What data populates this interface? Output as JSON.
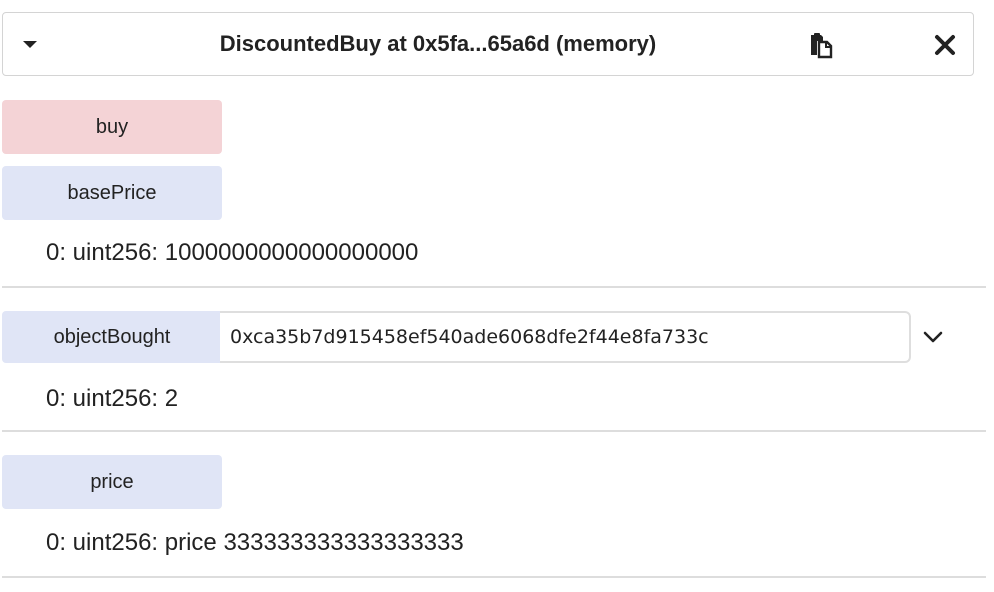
{
  "header": {
    "title": "DiscountedBuy at 0x5fa...65a6d (memory)",
    "collapse_icon": "caret-down-icon",
    "copy_icon": "copy-icon",
    "close_icon": "close-icon"
  },
  "functions": [
    {
      "label": "buy",
      "kind": "transact",
      "color": "#f4d3d6"
    },
    {
      "label": "basePrice",
      "kind": "call",
      "color": "#e0e5f6",
      "output": "0: uint256: 1000000000000000000"
    },
    {
      "label": "objectBought",
      "kind": "call",
      "color": "#e0e5f6",
      "input_value": "0xca35b7d915458ef540ade6068dfe2f44e8fa733c",
      "expand_icon": "chevron-down-icon",
      "output": "0: uint256: 2"
    },
    {
      "label": "price",
      "kind": "call",
      "color": "#e0e5f6",
      "output": "0: uint256: price 333333333333333333"
    }
  ]
}
